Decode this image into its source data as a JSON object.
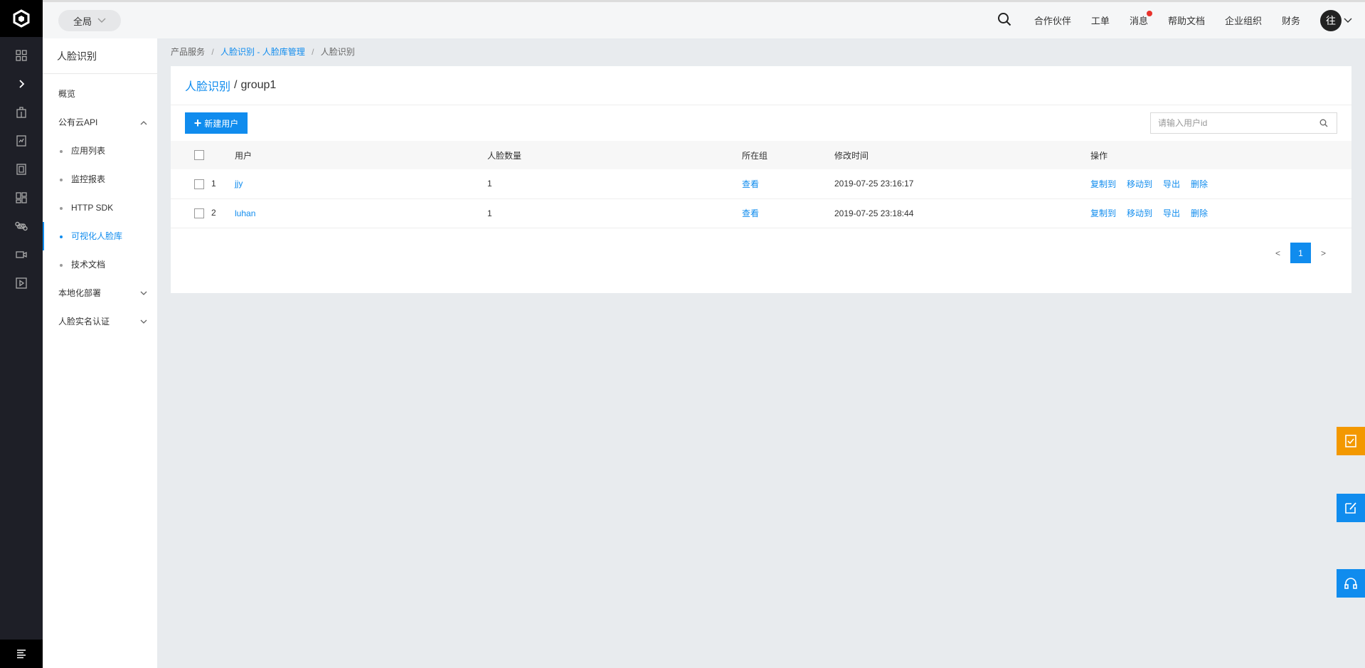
{
  "topbar": {
    "scope_label": "全局",
    "nav": [
      "合作伙伴",
      "工单",
      "消息",
      "帮助文档",
      "企业组织",
      "财务"
    ],
    "avatar_text": "往"
  },
  "sidebar": {
    "title": "人脸识别",
    "overview": "概览",
    "public_api": "公有云API",
    "sub_items": [
      "应用列表",
      "监控报表",
      "HTTP SDK",
      "可视化人脸库",
      "技术文档"
    ],
    "local_deploy": "本地化部署",
    "realname": "人脸实名认证"
  },
  "breadcrumb": {
    "root": "产品服务",
    "mid": "人脸识别 - 人脸库管理",
    "current": "人脸识别"
  },
  "card": {
    "title_link": "人脸识别",
    "title_current": "group1",
    "new_button": "新建用户",
    "search_placeholder": "请输入用户id"
  },
  "table": {
    "headers": [
      "用户",
      "人脸数量",
      "所在组",
      "修改时间",
      "操作"
    ],
    "rows": [
      {
        "num": "1",
        "user": "jjy",
        "count": "1",
        "group": "查看",
        "time": "2019-07-25 23:16:17"
      },
      {
        "num": "2",
        "user": "luhan",
        "count": "1",
        "group": "查看",
        "time": "2019-07-25 23:18:44"
      }
    ],
    "ops": [
      "复制到",
      "移动到",
      "导出",
      "删除"
    ]
  },
  "pager": {
    "prev": "<",
    "page": "1",
    "next": ">"
  },
  "colors": {
    "accent": "#108cee",
    "float_orange": "#f39800",
    "float_blue": "#108cee",
    "rail": "#1e1f27"
  }
}
